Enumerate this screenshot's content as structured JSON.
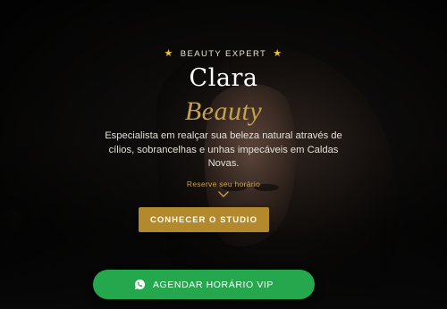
{
  "hero": {
    "eyebrow": "BEAUTY EXPERT",
    "title_line1": "Clara",
    "title_line2": "Beauty",
    "description": "Especialista em realçar sua beleza natural através de cílios, sobrancelhas e unhas impecáveis em Caldas Novas.",
    "reserve_link": "Reserve seu horário",
    "cta_label": "CONHECER O STUDIO"
  },
  "floating_cta": {
    "label": "AGENDAR HORÁRIO VIP"
  },
  "icons": {
    "eyebrow_left": "star-icon",
    "eyebrow_right": "star-icon",
    "scroll_hint": "chevron-down-icon",
    "whatsapp": "whatsapp-icon"
  },
  "colors": {
    "gold_accent": "#c9a14a",
    "cta_gold": "#b3892d",
    "whatsapp_green": "#25a84d",
    "star_yellow": "#f3c32c"
  }
}
